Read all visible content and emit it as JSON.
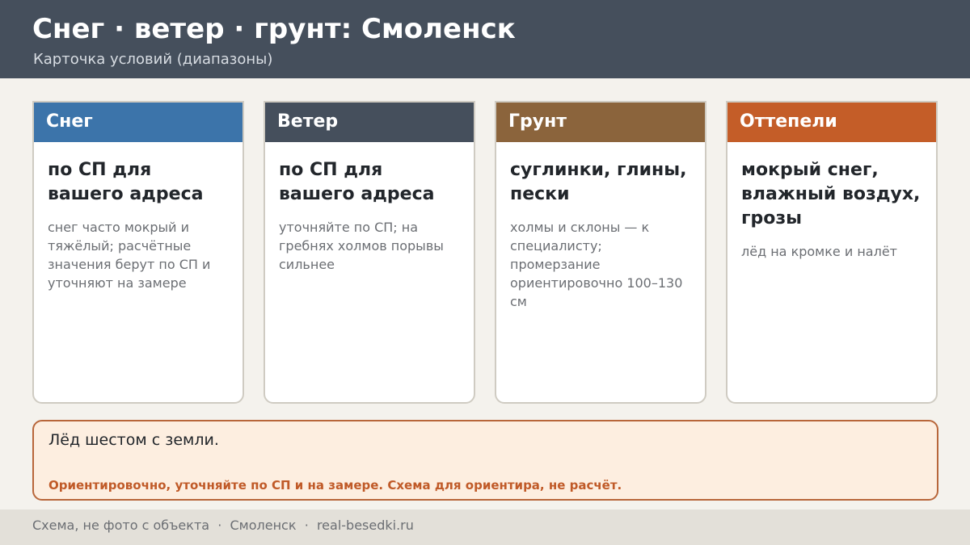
{
  "header": {
    "title": "Снег · ветер · грунт: Смоленск",
    "subtitle": "Карточка условий (диапазоны)"
  },
  "cards": [
    {
      "heading": "Снег",
      "main": "по СП для вашего адреса",
      "note": "снег часто мокрый и тяжёлый; расчётные значения берут по СП и уточняют на замере",
      "color": "#3c74aa"
    },
    {
      "heading": "Ветер",
      "main": "по СП для вашего адреса",
      "note": "уточняйте по СП; на гребнях холмов порывы сильнее",
      "color": "#454f5c"
    },
    {
      "heading": "Грунт",
      "main": "суглинки, глины, пески",
      "note": "холмы и склоны — к специалисту; промерзание ориентировочно 100–130 см",
      "color": "#8b643c"
    },
    {
      "heading": "Оттепели",
      "main": "мокрый снег, влажный воздух, грозы",
      "note": "лёд на кромке и налёт",
      "color": "#c45d28"
    }
  ],
  "note_box": {
    "main": "Лёд шестом с земли.",
    "warning": "Ориентировочно, уточняйте по СП и на замере. Схема для ориентира, не расчёт."
  },
  "footer": {
    "text": "Схема, не фото с объекта  ·  Смоленск  ·  real-besedki.ru"
  }
}
